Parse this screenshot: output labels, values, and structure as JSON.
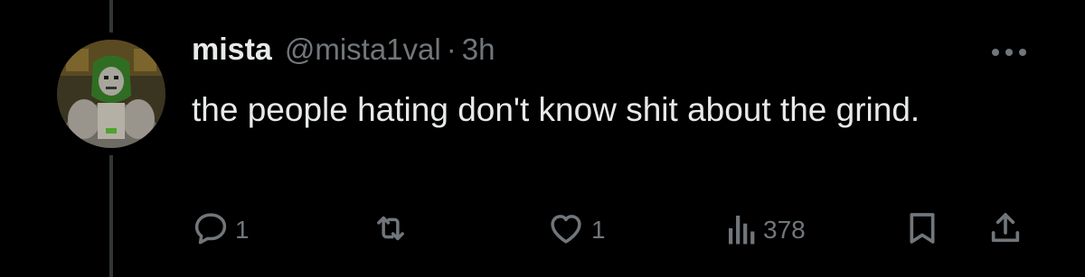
{
  "tweet": {
    "display_name": "mista",
    "handle": "@mista1val",
    "separator": "·",
    "time": "3h",
    "text": "the people hating don't know shit about the grind."
  },
  "actions": {
    "reply_count": "1",
    "retweet_count": "",
    "like_count": "1",
    "views_count": "378"
  },
  "icons": {
    "more": "more-horizontal-icon",
    "reply": "reply-icon",
    "retweet": "retweet-icon",
    "like": "heart-icon",
    "views": "views-icon",
    "bookmark": "bookmark-icon",
    "share": "share-icon"
  },
  "colors": {
    "background": "#000000",
    "primary_text": "#e7e9ea",
    "secondary_text": "#71767b",
    "thread_line": "#333639"
  }
}
